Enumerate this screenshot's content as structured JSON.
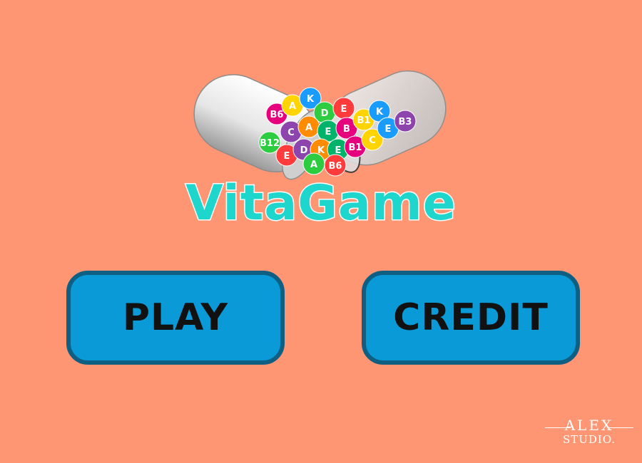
{
  "logo": {
    "title": "VitaGame",
    "ball_letters": [
      "B6",
      "A",
      "K",
      "D",
      "E",
      "C",
      "A",
      "E",
      "B",
      "B1",
      "K",
      "B12",
      "E",
      "D",
      "K",
      "E",
      "B1",
      "C",
      "E",
      "A",
      "B6",
      "B3"
    ]
  },
  "buttons": {
    "play_label": "PLAY",
    "credit_label": "CREDIT"
  },
  "studio": {
    "name": "ALEX",
    "sub": "STUDIO."
  },
  "colors": {
    "background": "#fe9673",
    "button_fill": "#0b9ad8",
    "button_border": "#0f5f83",
    "logo_text": "#1fd6cc"
  }
}
